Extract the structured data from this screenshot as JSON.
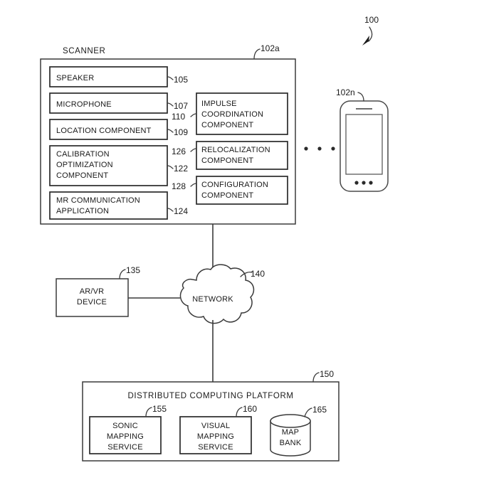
{
  "figure": {
    "figure_ref": "100",
    "scanner_label": "SCANNER",
    "scanner_ref": "102a",
    "phone_ref": "102n",
    "ellipsis": "• • •"
  },
  "scanner": {
    "left_components": [
      {
        "label": "SPEAKER",
        "ref": "105"
      },
      {
        "label": "MICROPHONE",
        "ref": "107"
      },
      {
        "label": "LOCATION COMPONENT",
        "ref": "109"
      },
      {
        "label": "CALIBRATION OPTIMIZATION COMPONENT",
        "ref": "122"
      },
      {
        "label": "MR COMMUNICATION APPLICATION",
        "ref": "124"
      }
    ],
    "left_component_lines": [
      [
        "SPEAKER"
      ],
      [
        "MICROPHONE"
      ],
      [
        "LOCATION COMPONENT"
      ],
      [
        "CALIBRATION",
        "OPTIMIZATION",
        "COMPONENT"
      ],
      [
        "MR COMMUNICATION",
        "APPLICATION"
      ]
    ],
    "right_components": [
      {
        "label": "IMPULSE COORDINATION COMPONENT",
        "ref": "110"
      },
      {
        "label": "RELOCALIZATION COMPONENT",
        "ref": "126"
      },
      {
        "label": "CONFIGURATION COMPONENT",
        "ref": "128"
      }
    ],
    "right_component_lines": [
      [
        "IMPULSE",
        "COORDINATION",
        "COMPONENT"
      ],
      [
        "RELOCALIZATION",
        "COMPONENT"
      ],
      [
        "CONFIGURATION",
        "COMPONENT"
      ]
    ]
  },
  "arvr": {
    "lines": [
      "AR/VR",
      "DEVICE"
    ],
    "ref": "135"
  },
  "network": {
    "label": "NETWORK",
    "ref": "140"
  },
  "platform": {
    "title": "DISTRIBUTED COMPUTING PLATFORM",
    "ref": "150",
    "services": [
      {
        "lines": [
          "SONIC",
          "MAPPING",
          "SERVICE"
        ],
        "ref": "155"
      },
      {
        "lines": [
          "VISUAL",
          "MAPPING",
          "SERVICE"
        ],
        "ref": "160"
      }
    ],
    "database": {
      "lines": [
        "MAP",
        "BANK"
      ],
      "ref": "165"
    }
  },
  "colors": {
    "ink": "#1a1a1a",
    "stroke": "#3a3a3a",
    "paper": "#ffffff"
  }
}
